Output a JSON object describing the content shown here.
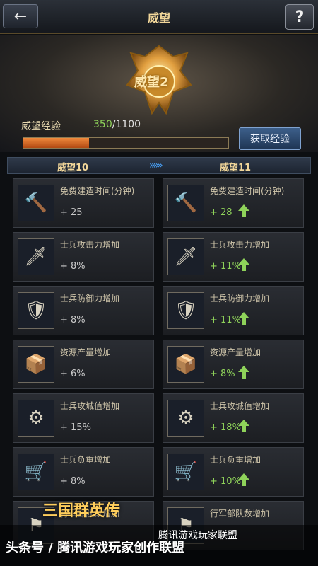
{
  "header": {
    "title": "威望",
    "back_icon": "←",
    "help_icon": "?"
  },
  "emblem": {
    "text": "威望2"
  },
  "experience": {
    "label": "威望经验",
    "current": "350",
    "max": "/1100",
    "progress": 0.32,
    "button_label": "获取经验"
  },
  "levels": {
    "left": "威望10",
    "right": "威望11",
    "arrows": "»»»"
  },
  "stats": [
    {
      "label": "免费建造时间(分钟)",
      "left_value": "+ 25",
      "right_value": "+ 28",
      "icon": "🔨"
    },
    {
      "label": "士兵攻击力增加",
      "left_value": "+ 8%",
      "right_value": "+ 11%",
      "icon": "🗡"
    },
    {
      "label": "士兵防御力增加",
      "left_value": "+ 8%",
      "right_value": "+ 11%",
      "icon": "🛡"
    },
    {
      "label": "资源产量增加",
      "left_value": "+ 6%",
      "right_value": "+ 8%",
      "icon": "📦"
    },
    {
      "label": "士兵攻城值增加",
      "left_value": "+ 15%",
      "right_value": "+ 18%",
      "icon": "⚙"
    },
    {
      "label": "士兵负重增加",
      "left_value": "+ 8%",
      "right_value": "+ 10%",
      "icon": "🛒"
    },
    {
      "label": "行军部队数增加",
      "left_value": "",
      "right_value": "",
      "icon": "⚑"
    }
  ],
  "watermark": {
    "logo": "三国群英传",
    "platform": "腾讯游戏玩家联盟",
    "credit": "头条号 / 腾讯游戏玩家创作联盟"
  },
  "colors": {
    "accent_gold": "#f2d79a",
    "increase_green": "#8fd35a",
    "exp_bar": "#f08a3c"
  }
}
